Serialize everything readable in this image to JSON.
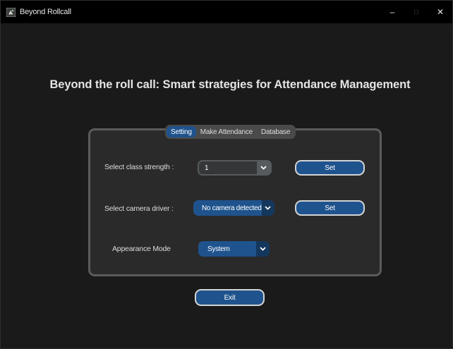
{
  "window": {
    "title": "Beyond Rollcall",
    "minimize_glyph": "–",
    "maximize_glyph": "□",
    "close_glyph": "✕"
  },
  "page": {
    "heading": "Beyond the roll call: Smart strategies for Attendance Management"
  },
  "tabs": [
    {
      "label": "Setting",
      "active": true
    },
    {
      "label": "Make Attendance",
      "active": false
    },
    {
      "label": "Database",
      "active": false
    }
  ],
  "settings": {
    "class_strength": {
      "label": "Select class strength :",
      "value": "1",
      "button": "Set"
    },
    "camera_driver": {
      "label": "Select camera driver :",
      "value": "No camera detected",
      "button": "Set"
    },
    "appearance": {
      "label": "Appearance Mode",
      "value": "System"
    }
  },
  "exit_button": "Exit",
  "colors": {
    "background": "#1a1a1a",
    "panel": "#2a2a2a",
    "accent_blue": "#1f538d",
    "dark_blue": "#14375e"
  },
  "icons": {
    "app": "app-icon",
    "dropdown": "chevron-down-icon"
  }
}
